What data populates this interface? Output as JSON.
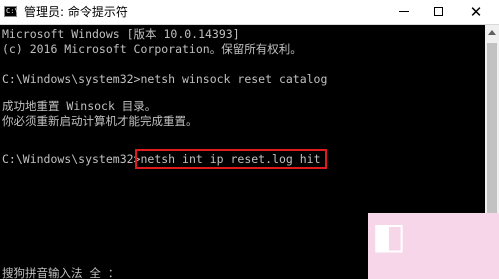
{
  "window": {
    "title": "管理员: 命令提示符",
    "icon_name": "cmd-icon",
    "icon_text": "C:\\",
    "buttons": [
      "minimize",
      "maximize",
      "close"
    ]
  },
  "console": {
    "background": "#000000",
    "text_color": "#c0c0c0",
    "lines": [
      "Microsoft Windows [版本 10.0.14393]",
      "(c) 2016 Microsoft Corporation。保留所有权利。",
      "C:\\Windows\\system32>netsh winsock reset catalog",
      "成功地重置 Winsock 目录。",
      "你必须重新启动计算机才能完成重置。",
      "C:\\Windows\\system32>",
      "搜狗拼音输入法 全 ："
    ],
    "highlighted_command": "netsh int ip reset.log hit",
    "highlight_color": "#e01b1b"
  },
  "watermark": {
    "color": "#f7d6ea"
  }
}
